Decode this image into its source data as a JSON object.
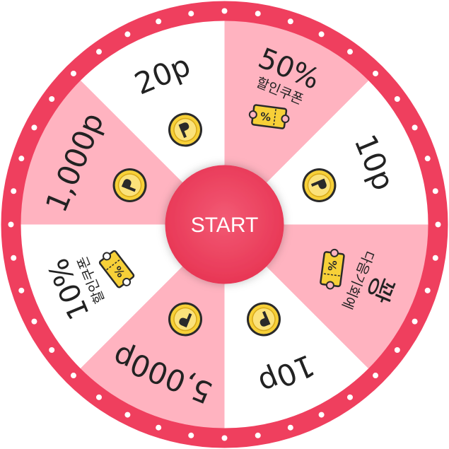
{
  "wheel": {
    "start_label": "START",
    "colors": {
      "rim": "#ef3f5e",
      "rim_dots": "#ffffff",
      "segment_pink": "#ffb3c0",
      "segment_white": "#ffffff",
      "hub": "#ef3f5e",
      "coin_outer": "#2a2a2a",
      "coin_ring": "#f7d038",
      "coin_inner": "#fbe27a",
      "coupon_fill": "#f7d038",
      "text": "#222222"
    },
    "segments": [
      {
        "label": "50%",
        "sub_label": "할인쿠폰",
        "icon": "coupon-icon",
        "color": "pink"
      },
      {
        "label": "10p",
        "sub_label": "",
        "icon": "coin-icon",
        "color": "white"
      },
      {
        "label": "꽝",
        "sub_label": "다음기회에",
        "icon": "coupon-icon",
        "color": "pink"
      },
      {
        "label": "10p",
        "sub_label": "",
        "icon": "coin-icon",
        "color": "white"
      },
      {
        "label": "5,000p",
        "sub_label": "",
        "icon": "coin-icon",
        "color": "pink"
      },
      {
        "label": "10%",
        "sub_label": "할인쿠폰",
        "icon": "coupon-icon",
        "color": "white"
      },
      {
        "label": "1,000p",
        "sub_label": "",
        "icon": "coin-icon",
        "color": "pink"
      },
      {
        "label": "20p",
        "sub_label": "",
        "icon": "coin-icon",
        "color": "white"
      }
    ]
  }
}
